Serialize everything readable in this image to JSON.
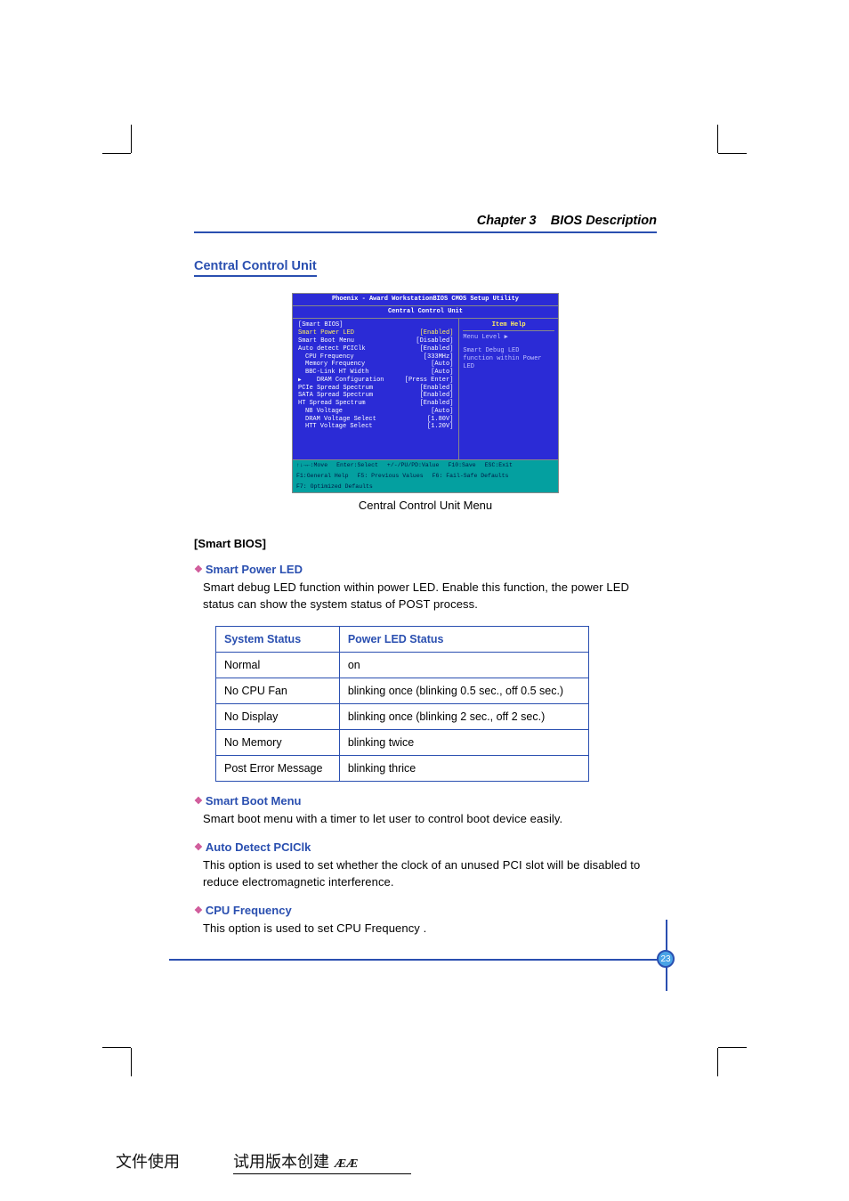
{
  "chapter": {
    "number": "Chapter 3",
    "title": "BIOS Description"
  },
  "h2": "Central Control Unit",
  "bios": {
    "title1": "Phoenix - Award WorkstationBIOS CMOS Setup Utility",
    "title2": "Central Control Unit",
    "help_hdr": "Item Help",
    "menu_level": "Menu Level  ▶",
    "help_text1": "Smart Debug LED",
    "help_text2": "function within Power",
    "help_text3": "LED",
    "group": "[Smart BIOS]",
    "rows": [
      {
        "lbl": "Smart Power LED",
        "val": "[Enabled]",
        "cls": "yellow"
      },
      {
        "lbl": "Smart Boot Menu",
        "val": "[Disabled]",
        "cls": ""
      },
      {
        "lbl": "Auto detect PCIClk",
        "val": "[Enabled]",
        "cls": ""
      },
      {
        "lbl": "CPU Frequency",
        "val": "[333MHz]",
        "cls": "sub"
      },
      {
        "lbl": "Memory Frequency",
        "val": "[Auto]",
        "cls": "sub"
      },
      {
        "lbl": "BBC-Link HT Width",
        "val": "[Auto]",
        "cls": "sub"
      },
      {
        "lbl": "DRAM Configuration",
        "val": "[Press Enter]",
        "cls": "tri"
      },
      {
        "lbl": "PCIe Spread Spectrum",
        "val": "[Enabled]",
        "cls": ""
      },
      {
        "lbl": "SATA Spread Spectrum",
        "val": "[Enabled]",
        "cls": ""
      },
      {
        "lbl": "HT Spread Spectrum",
        "val": "[Enabled]",
        "cls": ""
      },
      {
        "lbl": "NB Voltage",
        "val": "[Auto]",
        "cls": "sub"
      },
      {
        "lbl": "DRAM Voltage Select",
        "val": "[1.80V]",
        "cls": "sub"
      },
      {
        "lbl": "HTT Voltage Select",
        "val": "[1.20V]",
        "cls": "sub"
      }
    ],
    "feet": [
      "↑↓→←:Move",
      "Enter:Select",
      "+/-/PU/PD:Value",
      "F10:Save",
      "ESC:Exit",
      "F1:General Help",
      "F5: Previous Values",
      "F6: Fail-Safe Defaults",
      "F7: Optimized Defaults"
    ]
  },
  "bios_caption": "Central Control Unit  Menu",
  "section_label": "[Smart BIOS]",
  "items": {
    "smart_power_led": {
      "title": "Smart Power LED",
      "body": "Smart debug LED function within power LED. Enable this function, the power LED status can show the system status of POST process."
    },
    "smart_boot_menu": {
      "title": "Smart Boot Menu",
      "body": "Smart boot menu with a timer to let user to control boot device easily."
    },
    "auto_detect_pciclk": {
      "title": "Auto Detect PCIClk",
      "body": "This option is used to set whether the clock of an unused PCI slot will be disabled to reduce electromagnetic interference."
    },
    "cpu_frequency": {
      "title": "CPU Frequency",
      "body": "This option is used to set CPU Frequency ."
    }
  },
  "table": {
    "headers": [
      "System Status",
      "Power LED Status"
    ],
    "rows": [
      [
        "Normal",
        "on"
      ],
      [
        "No CPU Fan",
        "blinking once (blinking 0.5 sec., off 0.5 sec.)"
      ],
      [
        "No Display",
        "blinking once (blinking 2 sec., off 2 sec.)"
      ],
      [
        "No Memory",
        "blinking twice"
      ],
      [
        "Post Error Message",
        "blinking thrice"
      ]
    ]
  },
  "page_number": "23",
  "footer": {
    "left": "文件使用",
    "mid": "试用版本创建",
    "brand": "ÆÆ"
  }
}
